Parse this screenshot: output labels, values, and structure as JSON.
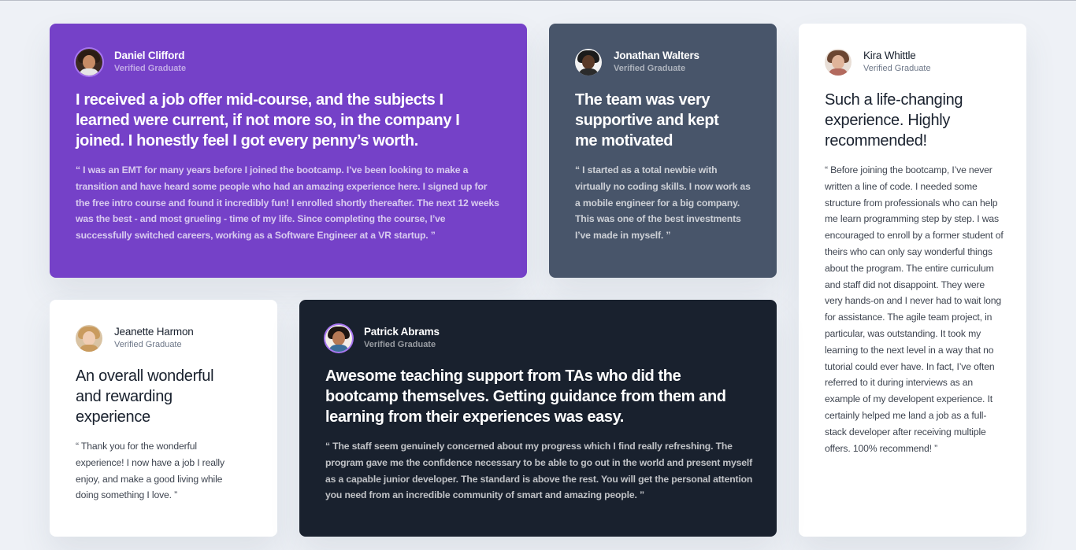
{
  "testimonials": [
    {
      "name": "Daniel Clifford",
      "role": "Verified Graduate",
      "headline": "I received a job offer mid-course, and the subjects I learned were current, if not more so, in the company I joined. I honestly feel I got every penny’s worth.",
      "quote": "“ I was an EMT for many years before I joined the bootcamp. I’ve been looking to make a transition and have heard some people who had an amazing experience here. I signed up for the free intro course and found it incredibly fun! I enrolled shortly thereafter. The next 12 weeks was the best - and most grueling - time of my life. Since completing the course, I’ve successfully switched careers, working as a Software Engineer at a VR startup. ”",
      "avatar_icon": "daniel-avatar-icon"
    },
    {
      "name": "Jonathan Walters",
      "role": "Verified Graduate",
      "headline": "The team was very supportive and kept me motivated",
      "quote": "“ I started as a total newbie with virtually no coding skills. I now work as a mobile engineer for a big company. This was one of the best investments I’ve made in myself. ”",
      "avatar_icon": "jonathan-avatar-icon"
    },
    {
      "name": "Kira Whittle",
      "role": "Verified Graduate",
      "headline": "Such a life-changing experience. Highly recommended!",
      "quote": "“ Before joining the bootcamp, I’ve never written a line of code. I needed some structure from professionals who can help me learn programming step by step. I was encouraged to enroll by a former student of theirs who can only say wonderful things about the program. The entire curriculum and staff did not disappoint. They were very hands-on and I never had to wait long for assistance. The agile team project, in particular, was outstanding. It took my learning to the next level in a way that no tutorial could ever have. In fact, I’ve often referred to it during interviews as an example of my developent experience. It certainly helped me land a job as a full-stack developer after receiving multiple offers. 100% recommend! ”",
      "avatar_icon": "kira-avatar-icon"
    },
    {
      "name": "Jeanette Harmon",
      "role": "Verified Graduate",
      "headline": "An overall wonderful and rewarding experience",
      "quote": "“ Thank you for the wonderful experience! I now have a job I really enjoy, and make a good living while doing something I love. ”",
      "avatar_icon": "jeanette-avatar-icon"
    },
    {
      "name": "Patrick Abrams",
      "role": "Verified Graduate",
      "headline": "Awesome teaching support from TAs who did the bootcamp themselves. Getting guidance from them and learning from their experiences was easy.",
      "quote": "“ The staff seem genuinely concerned about my progress which I find really refreshing. The program gave me the confidence necessary to be able to go out in the world and present myself as a capable junior developer. The standard is above the rest. You will get the personal attention you need from an incredible community of smart and amazing people. ”",
      "avatar_icon": "patrick-avatar-icon"
    }
  ],
  "colors": {
    "page_background": "#eef1f6",
    "purple": "#7541c8",
    "gray_blue": "#48556a",
    "white": "#ffffff",
    "dark": "#19212e",
    "avatar_ring": "#a775f1"
  }
}
